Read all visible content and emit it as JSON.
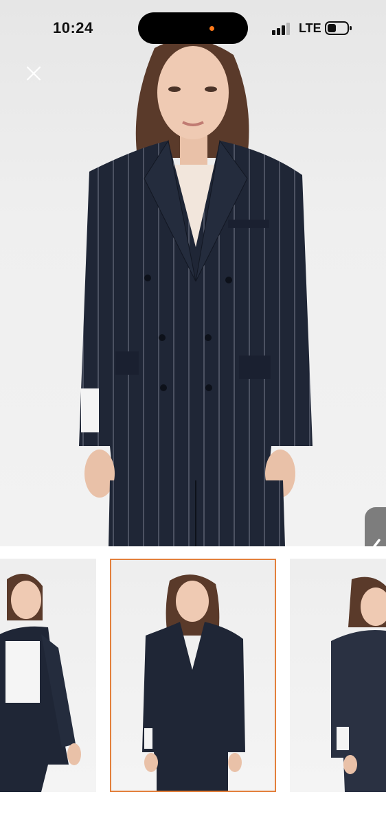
{
  "status_bar": {
    "time": "10:24",
    "network": "LTE",
    "icons": [
      "signal-icon",
      "battery-icon"
    ]
  },
  "viewer": {
    "close_icon": "close-icon",
    "side_tab_icon": "chevron-left-icon",
    "colors": {
      "accent": "#e3803c",
      "jacket": "#1f2636",
      "background": "#efefef"
    }
  },
  "thumbnails": {
    "count": 3,
    "selected_index": 1
  }
}
